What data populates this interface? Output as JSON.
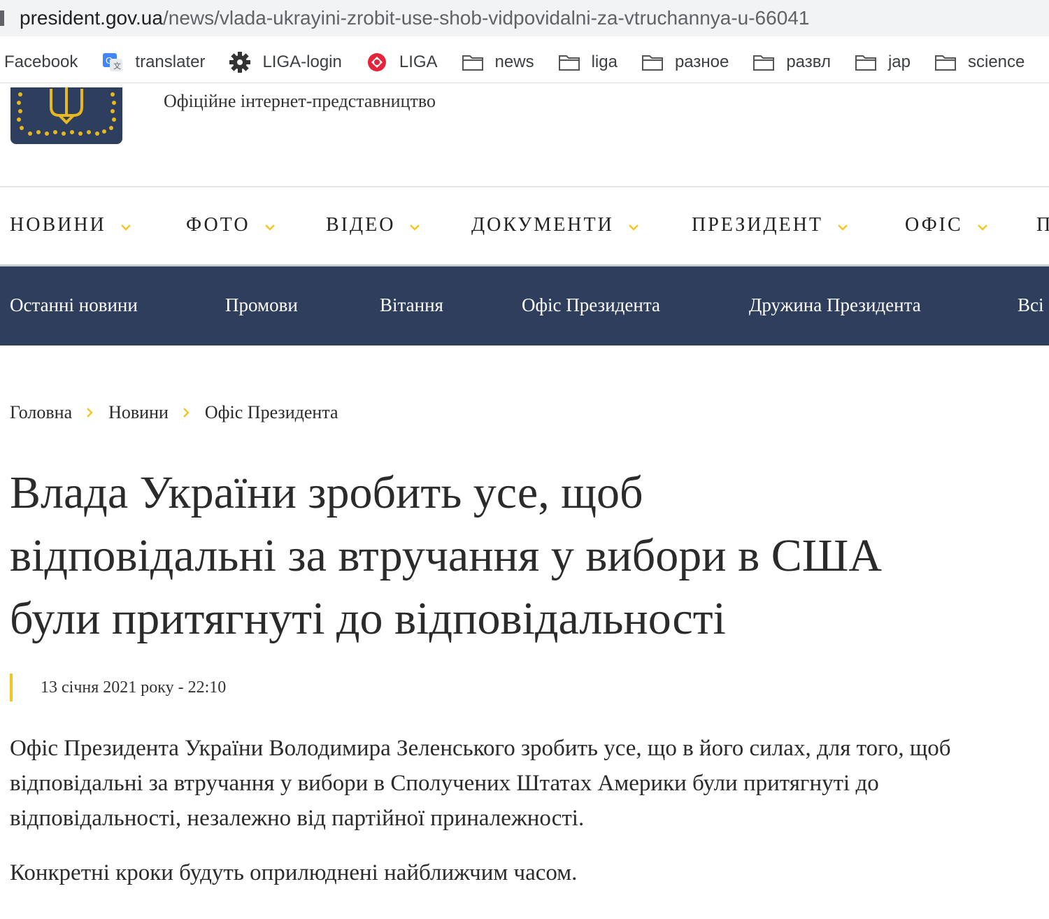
{
  "browser": {
    "url_domain": "president.gov.ua",
    "url_path": "/news/vlada-ukrayini-zrobit-use-shob-vidpovidalni-za-vtruchannya-u-66041",
    "bookmarks": [
      {
        "label": "Facebook",
        "icon": "none"
      },
      {
        "label": "translater",
        "icon": "google-translate-icon"
      },
      {
        "label": "LIGA-login",
        "icon": "gear-icon"
      },
      {
        "label": "LIGA",
        "icon": "liga-logo-icon"
      },
      {
        "label": "news",
        "icon": "folder-icon"
      },
      {
        "label": "liga",
        "icon": "folder-icon"
      },
      {
        "label": "разное",
        "icon": "folder-icon"
      },
      {
        "label": "развл",
        "icon": "folder-icon"
      },
      {
        "label": "jap",
        "icon": "folder-icon"
      },
      {
        "label": "science",
        "icon": "folder-icon"
      }
    ]
  },
  "header": {
    "subtitle": "Офіційне інтернет-представництво",
    "logo_icon": "trident-emblem-icon",
    "colors": {
      "navy": "#2e3e5c",
      "gold": "#f3c623"
    }
  },
  "main_nav": [
    "НОВИНИ",
    "ФОТО",
    "ВІДЕО",
    "ДОКУМЕНТИ",
    "ПРЕЗИДЕНТ",
    "ОФІС",
    "П"
  ],
  "sub_nav": [
    "Останні новини",
    "Промови",
    "Вітання",
    "Офіс Президента",
    "Дружина Президента",
    "Всі"
  ],
  "breadcrumb": [
    "Головна",
    "Новини",
    "Офіс Президента"
  ],
  "article": {
    "title_lines": [
      "Влада України зробить усе, щоб",
      "відповідальні за втручання у вибори в США",
      "були притягнуті до відповідальності"
    ],
    "date": "13 січня 2021 року - 22:10",
    "paragraphs": [
      "Офіс Президента України Володимира Зеленського зробить усе, що в його силах, для того, щоб відповідальні за втручання у вибори в Сполучених Штатах Америки були притягнуті до відповідальності, незалежно від партійної приналежності.",
      "Конкретні кроки будуть оприлюднені найближчим часом."
    ]
  }
}
